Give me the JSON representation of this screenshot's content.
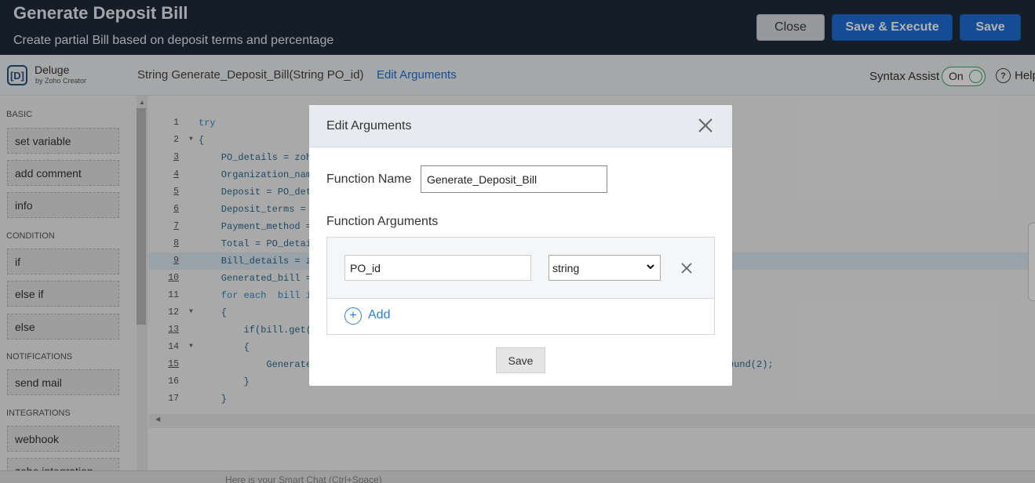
{
  "header": {
    "title": "Generate Deposit Bill",
    "subtitle": "Create partial Bill based on deposit terms and percentage",
    "buttons": {
      "close": "Close",
      "save_execute": "Save & Execute",
      "save": "Save"
    }
  },
  "toolbar": {
    "logo_letter": "[D]",
    "product": "Deluge",
    "by": "by Zoho Creator",
    "signature": "String  Generate_Deposit_Bill(String PO_id)",
    "edit_arguments": "Edit Arguments",
    "syntax_assist": "Syntax Assist",
    "syntax_state": "On",
    "help": "Help"
  },
  "sidebar": {
    "sections": [
      {
        "title": "BASIC",
        "items": [
          "set variable",
          "add comment",
          "info"
        ]
      },
      {
        "title": "CONDITION",
        "items": [
          "if",
          "else if",
          "else"
        ]
      },
      {
        "title": "NOTIFICATIONS",
        "items": [
          "send mail"
        ]
      },
      {
        "title": "INTEGRATIONS",
        "items": [
          "webhook",
          "zoho integration"
        ]
      }
    ]
  },
  "editor": {
    "lines": [
      {
        "n": "1",
        "text": "try",
        "fold": false,
        "underline": false
      },
      {
        "n": "2",
        "text": "{",
        "fold": true,
        "underline": false
      },
      {
        "n": "3",
        "text": "    PO_details = zoh",
        "fold": false,
        "underline": true
      },
      {
        "n": "4",
        "text": "    Organization_nam",
        "fold": false,
        "underline": true
      },
      {
        "n": "5",
        "text": "    Deposit = PO_det",
        "fold": false,
        "underline": true
      },
      {
        "n": "6",
        "text": "    Deposit_terms =",
        "fold": false,
        "underline": true
      },
      {
        "n": "7",
        "text": "    Payment_method =",
        "fold": false,
        "underline": true
      },
      {
        "n": "8",
        "text": "    Total = PO_detai",
        "fold": false,
        "underline": true
      },
      {
        "n": "9",
        "text": "    Bill_details = z",
        "fold": false,
        "underline": true,
        "highlight": true
      },
      {
        "n": "10",
        "text": "    Generated_bill =",
        "fold": false,
        "underline": true
      },
      {
        "n": "11",
        "text": "    for each  bill i",
        "fold": false,
        "underline": false
      },
      {
        "n": "12",
        "text": "    {",
        "fold": true,
        "underline": false
      },
      {
        "n": "13",
        "text": "        if(bill.get(",
        "fold": false,
        "underline": true
      },
      {
        "n": "14",
        "text": "        {",
        "fold": true,
        "underline": false
      },
      {
        "n": "15",
        "text": "            Generate",
        "fold": false,
        "underline": true,
        "tail": "ound(2);"
      },
      {
        "n": "16",
        "text": "        }",
        "fold": false,
        "underline": false
      },
      {
        "n": "17",
        "text": "    }",
        "fold": false,
        "underline": false
      }
    ]
  },
  "bottombar": {
    "hint": "Here is your Smart Chat (Ctrl+Space)"
  },
  "modal": {
    "title": "Edit Arguments",
    "function_name_label": "Function Name",
    "function_name_value": "Generate_Deposit_Bill",
    "function_arguments_label": "Function Arguments",
    "arguments": [
      {
        "name": "PO_id",
        "type": "string"
      }
    ],
    "add_label": "Add",
    "save_label": "Save"
  },
  "colors": {
    "header_bg": "#1f2a3c",
    "primary": "#1d6fd6",
    "accent_link": "#2e7fd1",
    "toggle_green": "#3aa26f"
  }
}
